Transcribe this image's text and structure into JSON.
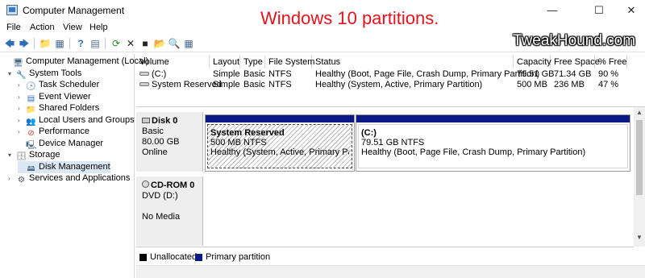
{
  "window": {
    "title": "Computer Management",
    "minimize": "—",
    "maximize": "☐",
    "close": "✕"
  },
  "overlay": {
    "title": "Windows 10 partitions.",
    "watermark": "TweakHound.com"
  },
  "menu": [
    "File",
    "Action",
    "View",
    "Help"
  ],
  "toolbar": {
    "back": "🡄",
    "forward": "🡆",
    "up": "📁",
    "show_hide": "▦",
    "help": "?",
    "properties": "▤",
    "refresh": "⟳",
    "delete": "✕",
    "open": "■",
    "folder": "📂",
    "search": "🔍",
    "grid": "▦"
  },
  "tree": [
    {
      "label": "Computer Management (Local)",
      "icon": "computer-management-icon",
      "glyph": "🖥",
      "arrow": ""
    },
    {
      "label": "System Tools",
      "icon": "system-tools-icon",
      "glyph": "🔧",
      "arrow": "▾"
    },
    {
      "label": "Task Scheduler",
      "icon": "task-scheduler-icon",
      "glyph": "🕒",
      "arrow": "›"
    },
    {
      "label": "Event Viewer",
      "icon": "event-viewer-icon",
      "glyph": "▤",
      "arrow": "›"
    },
    {
      "label": "Shared Folders",
      "icon": "shared-folders-icon",
      "glyph": "📁",
      "arrow": "›"
    },
    {
      "label": "Local Users and Groups",
      "icon": "local-users-icon",
      "glyph": "👥",
      "arrow": "›"
    },
    {
      "label": "Performance",
      "icon": "performance-icon",
      "glyph": "⊘",
      "arrow": "›"
    },
    {
      "label": "Device Manager",
      "icon": "device-manager-icon",
      "glyph": "🖳",
      "arrow": ""
    },
    {
      "label": "Storage",
      "icon": "storage-icon",
      "glyph": "🗄",
      "arrow": "▾"
    },
    {
      "label": "Disk Management",
      "icon": "disk-management-icon",
      "glyph": "🖴",
      "arrow": ""
    },
    {
      "label": "Services and Applications",
      "icon": "services-icon",
      "glyph": "⚙",
      "arrow": "›"
    }
  ],
  "volumes": {
    "columns": [
      "Volume",
      "Layout",
      "Type",
      "File System",
      "Status",
      "Capacity",
      "Free Space",
      "% Free"
    ],
    "rows": [
      [
        "(C:)",
        "Simple",
        "Basic",
        "NTFS",
        "Healthy (Boot, Page File, Crash Dump, Primary Partition)",
        "79.51 GB",
        "71.34 GB",
        "90 %"
      ],
      [
        "System Reserved",
        "Simple",
        "Basic",
        "NTFS",
        "Healthy (System, Active, Primary Partition)",
        "500 MB",
        "236 MB",
        "47 %"
      ]
    ]
  },
  "disks": {
    "disk0": {
      "name": "Disk 0",
      "type": "Basic",
      "size": "80.00 GB",
      "state": "Online"
    },
    "cdrom0": {
      "name": "CD-ROM 0",
      "type": "DVD (D:)",
      "state": "No Media"
    }
  },
  "partitions": {
    "sysres": {
      "name": "System Reserved",
      "size": "500 MB NTFS",
      "status": "Healthy (System, Active, Primary Partition)"
    },
    "c": {
      "name": "(C:)",
      "size": "79.51 GB NTFS",
      "status": "Healthy (Boot, Page File, Crash Dump, Primary Partition)"
    }
  },
  "legend": [
    {
      "label": "Unallocated",
      "color": "#000000"
    },
    {
      "label": "Primary partition",
      "color": "#0a1a86"
    }
  ],
  "colors": {
    "overlay_title": "#e0141e",
    "primary_partition": "#0a1a86"
  }
}
